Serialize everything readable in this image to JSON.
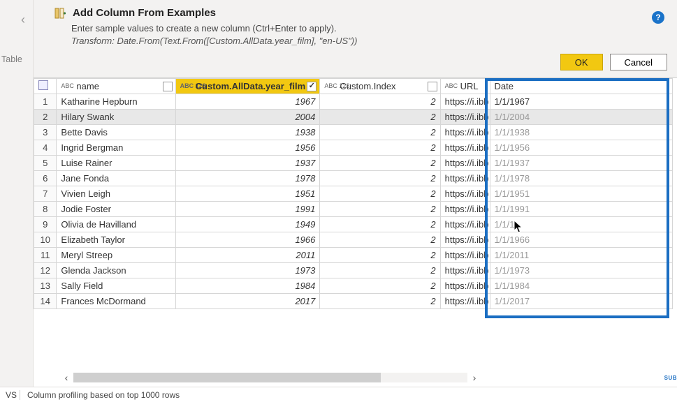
{
  "sidebar": {
    "table_label": "Table"
  },
  "header": {
    "title": "Add Column From Examples",
    "subtitle": "Enter sample values to create a new column (Ctrl+Enter to apply).",
    "transform_line": "Transform: Date.From(Text.From([Custom.AllData.year_film], \"en-US\"))",
    "ok_label": "OK",
    "cancel_label": "Cancel",
    "help_tooltip": "?"
  },
  "columns": {
    "name": {
      "label": "name",
      "type_icon": "ABC"
    },
    "year": {
      "label": "Custom.AllData.year_film",
      "type_icon": "ABC 123"
    },
    "index": {
      "label": "Custom.Index",
      "type_icon": "ABC 123"
    },
    "url": {
      "label": "URL",
      "type_icon": "ABC"
    },
    "date": {
      "label": "Date"
    }
  },
  "rows": [
    {
      "n": "1",
      "name": "Katharine Hepburn",
      "year": "1967",
      "index": "2",
      "url": "https://i.ibb",
      "date": "1/1/1967"
    },
    {
      "n": "2",
      "name": "Hilary Swank",
      "year": "2004",
      "index": "2",
      "url": "https://i.ibb",
      "date": "1/1/2004"
    },
    {
      "n": "3",
      "name": "Bette Davis",
      "year": "1938",
      "index": "2",
      "url": "https://i.ibb",
      "date": "1/1/1938"
    },
    {
      "n": "4",
      "name": "Ingrid Bergman",
      "year": "1956",
      "index": "2",
      "url": "https://i.ibb",
      "date": "1/1/1956"
    },
    {
      "n": "5",
      "name": "Luise Rainer",
      "year": "1937",
      "index": "2",
      "url": "https://i.ibb",
      "date": "1/1/1937"
    },
    {
      "n": "6",
      "name": "Jane Fonda",
      "year": "1978",
      "index": "2",
      "url": "https://i.ibb",
      "date": "1/1/1978"
    },
    {
      "n": "7",
      "name": "Vivien Leigh",
      "year": "1951",
      "index": "2",
      "url": "https://i.ibb",
      "date": "1/1/1951"
    },
    {
      "n": "8",
      "name": "Jodie Foster",
      "year": "1991",
      "index": "2",
      "url": "https://i.ibb",
      "date": "1/1/1991"
    },
    {
      "n": "9",
      "name": "Olivia de Havilland",
      "year": "1949",
      "index": "2",
      "url": "https://i.ibb",
      "date": "1/1/1"
    },
    {
      "n": "10",
      "name": "Elizabeth Taylor",
      "year": "1966",
      "index": "2",
      "url": "https://i.ibb",
      "date": "1/1/1966"
    },
    {
      "n": "11",
      "name": "Meryl Streep",
      "year": "2011",
      "index": "2",
      "url": "https://i.ibb",
      "date": "1/1/2011"
    },
    {
      "n": "12",
      "name": "Glenda Jackson",
      "year": "1973",
      "index": "2",
      "url": "https://i.ibb",
      "date": "1/1/1973"
    },
    {
      "n": "13",
      "name": "Sally Field",
      "year": "1984",
      "index": "2",
      "url": "https://i.ibb",
      "date": "1/1/1984"
    },
    {
      "n": "14",
      "name": "Frances McDormand",
      "year": "2017",
      "index": "2",
      "url": "https://i.ibb",
      "date": "1/1/2017"
    }
  ],
  "footer": {
    "left_segment": "VS",
    "profiling": "Column profiling based on top 1000 rows"
  },
  "badge": "SUB"
}
